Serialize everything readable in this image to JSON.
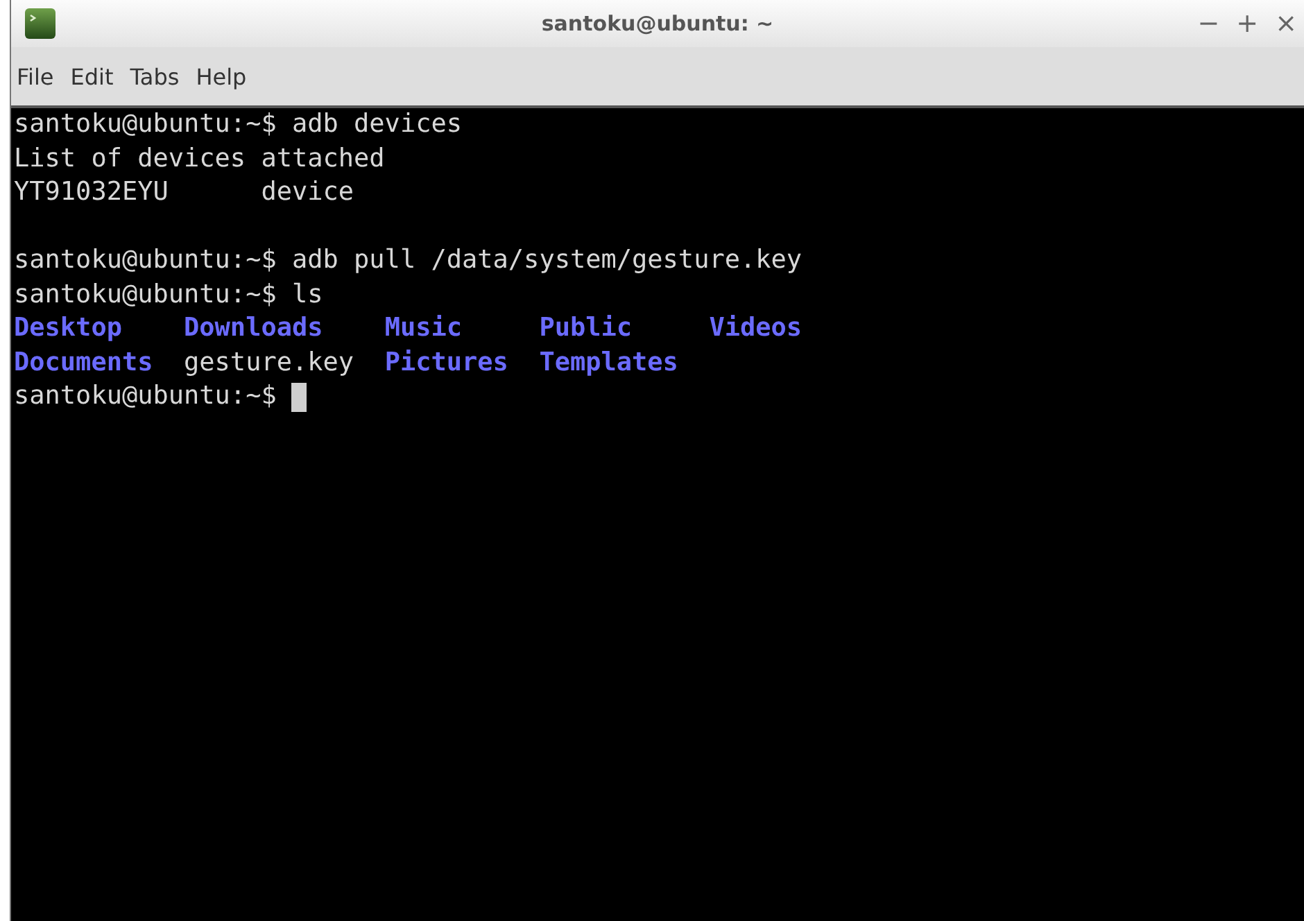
{
  "window": {
    "title": "santoku@ubuntu: ~",
    "controls": [
      "−",
      "+",
      "×"
    ]
  },
  "menu": [
    "File",
    "Edit",
    "Tabs",
    "Help"
  ],
  "terminal": {
    "lines": [
      {
        "kind": "text",
        "text": "santoku@ubuntu:~$ adb devices"
      },
      {
        "kind": "text",
        "text": "List of devices attached"
      },
      {
        "kind": "text",
        "text": "YT91032EYU      device"
      },
      {
        "kind": "blank"
      },
      {
        "kind": "text",
        "text": "santoku@ubuntu:~$ adb pull /data/system/gesture.key"
      },
      {
        "kind": "text",
        "text": "santoku@ubuntu:~$ ls"
      },
      {
        "kind": "listing",
        "rows": [
          [
            {
              "name": "Desktop",
              "kind": "dir"
            },
            {
              "name": "Downloads",
              "kind": "dir"
            },
            {
              "name": "Music",
              "kind": "dir"
            },
            {
              "name": "Public",
              "kind": "dir"
            },
            {
              "name": "Videos",
              "kind": "dir"
            }
          ],
          [
            {
              "name": "Documents",
              "kind": "dir"
            },
            {
              "name": "gesture.key",
              "kind": "file"
            },
            {
              "name": "Pictures",
              "kind": "dir"
            },
            {
              "name": "Templates",
              "kind": "dir"
            }
          ]
        ]
      },
      {
        "kind": "prompt",
        "text": "santoku@ubuntu:~$"
      }
    ]
  }
}
